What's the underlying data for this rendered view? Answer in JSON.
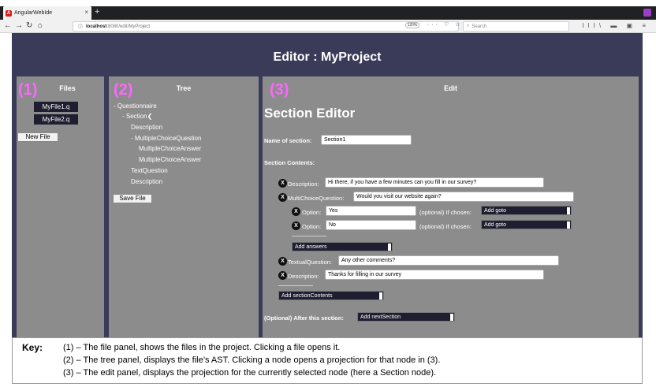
{
  "browser": {
    "tab_title": "AngularWebIde",
    "tab_close": "×",
    "new_tab": "+",
    "url_host": "localhost",
    "url_rest": ":8080/edit/MyProject",
    "zoom": "120%",
    "search_placeholder": "Search",
    "url_icons": "···  ♡  ☆",
    "tool_icons": "III\\  ▬  ▣  ≡"
  },
  "app": {
    "title": "Editor : MyProject"
  },
  "files_panel": {
    "marker": "(1)",
    "heading": "Files",
    "files": [
      "MyFile1.q",
      "MyFile2.q"
    ],
    "new_file_label": "New File"
  },
  "tree_panel": {
    "marker": "(2)",
    "heading": "Tree",
    "nodes": [
      "- Questionnaire",
      "- Section❮",
      "Description",
      "- MultipleChoiceQuestion",
      "MultipleChoiceAnswer",
      "MultipleChoiceAnswer",
      "TextQuestion",
      "Description"
    ],
    "save_file_label": "Save File"
  },
  "edit_panel": {
    "marker": "(3)",
    "heading": "Edit",
    "title": "Section Editor",
    "name_label": "Name of section:",
    "name_value": "Section1",
    "contents_label": "Section Contents:",
    "x_label": "X",
    "description1_label": "Description:",
    "description1_value": "Hi there, if you have a few minutes can you fill in our survey?",
    "mcq_label": "MultiChoiceQuestion:",
    "mcq_value": "Would you visit our website again?",
    "option_label": "Option:",
    "option1_value": "Yes",
    "option2_value": "No",
    "optional_label": "(optional) If chosen:",
    "add_goto": "Add goto",
    "add_answers": "Add answers",
    "textual_label": "TextualQuestion:",
    "textual_value": "Any other comments?",
    "description2_label": "Description:",
    "description2_value": "Thanks for filling in our survey",
    "add_section_contents": "Add sectionContents",
    "after_label": "(Optional) After this section:",
    "add_next_section": "Add nextSection"
  },
  "key": {
    "title": "Key:",
    "lines": [
      "(1) – The file panel, shows the files in the project. Clicking a file opens it.",
      "(2) – The tree panel, displays the file’s AST. Clicking a node opens a projection for that node in (3).",
      "(3) – The edit panel, displays the projection for the currently selected node (here a Section node)."
    ]
  },
  "colors": {
    "app_background": "#3a3a59",
    "panel_background": "#8c8c8c",
    "marker": "#ff66ff",
    "dark_control": "#1e1e30"
  }
}
